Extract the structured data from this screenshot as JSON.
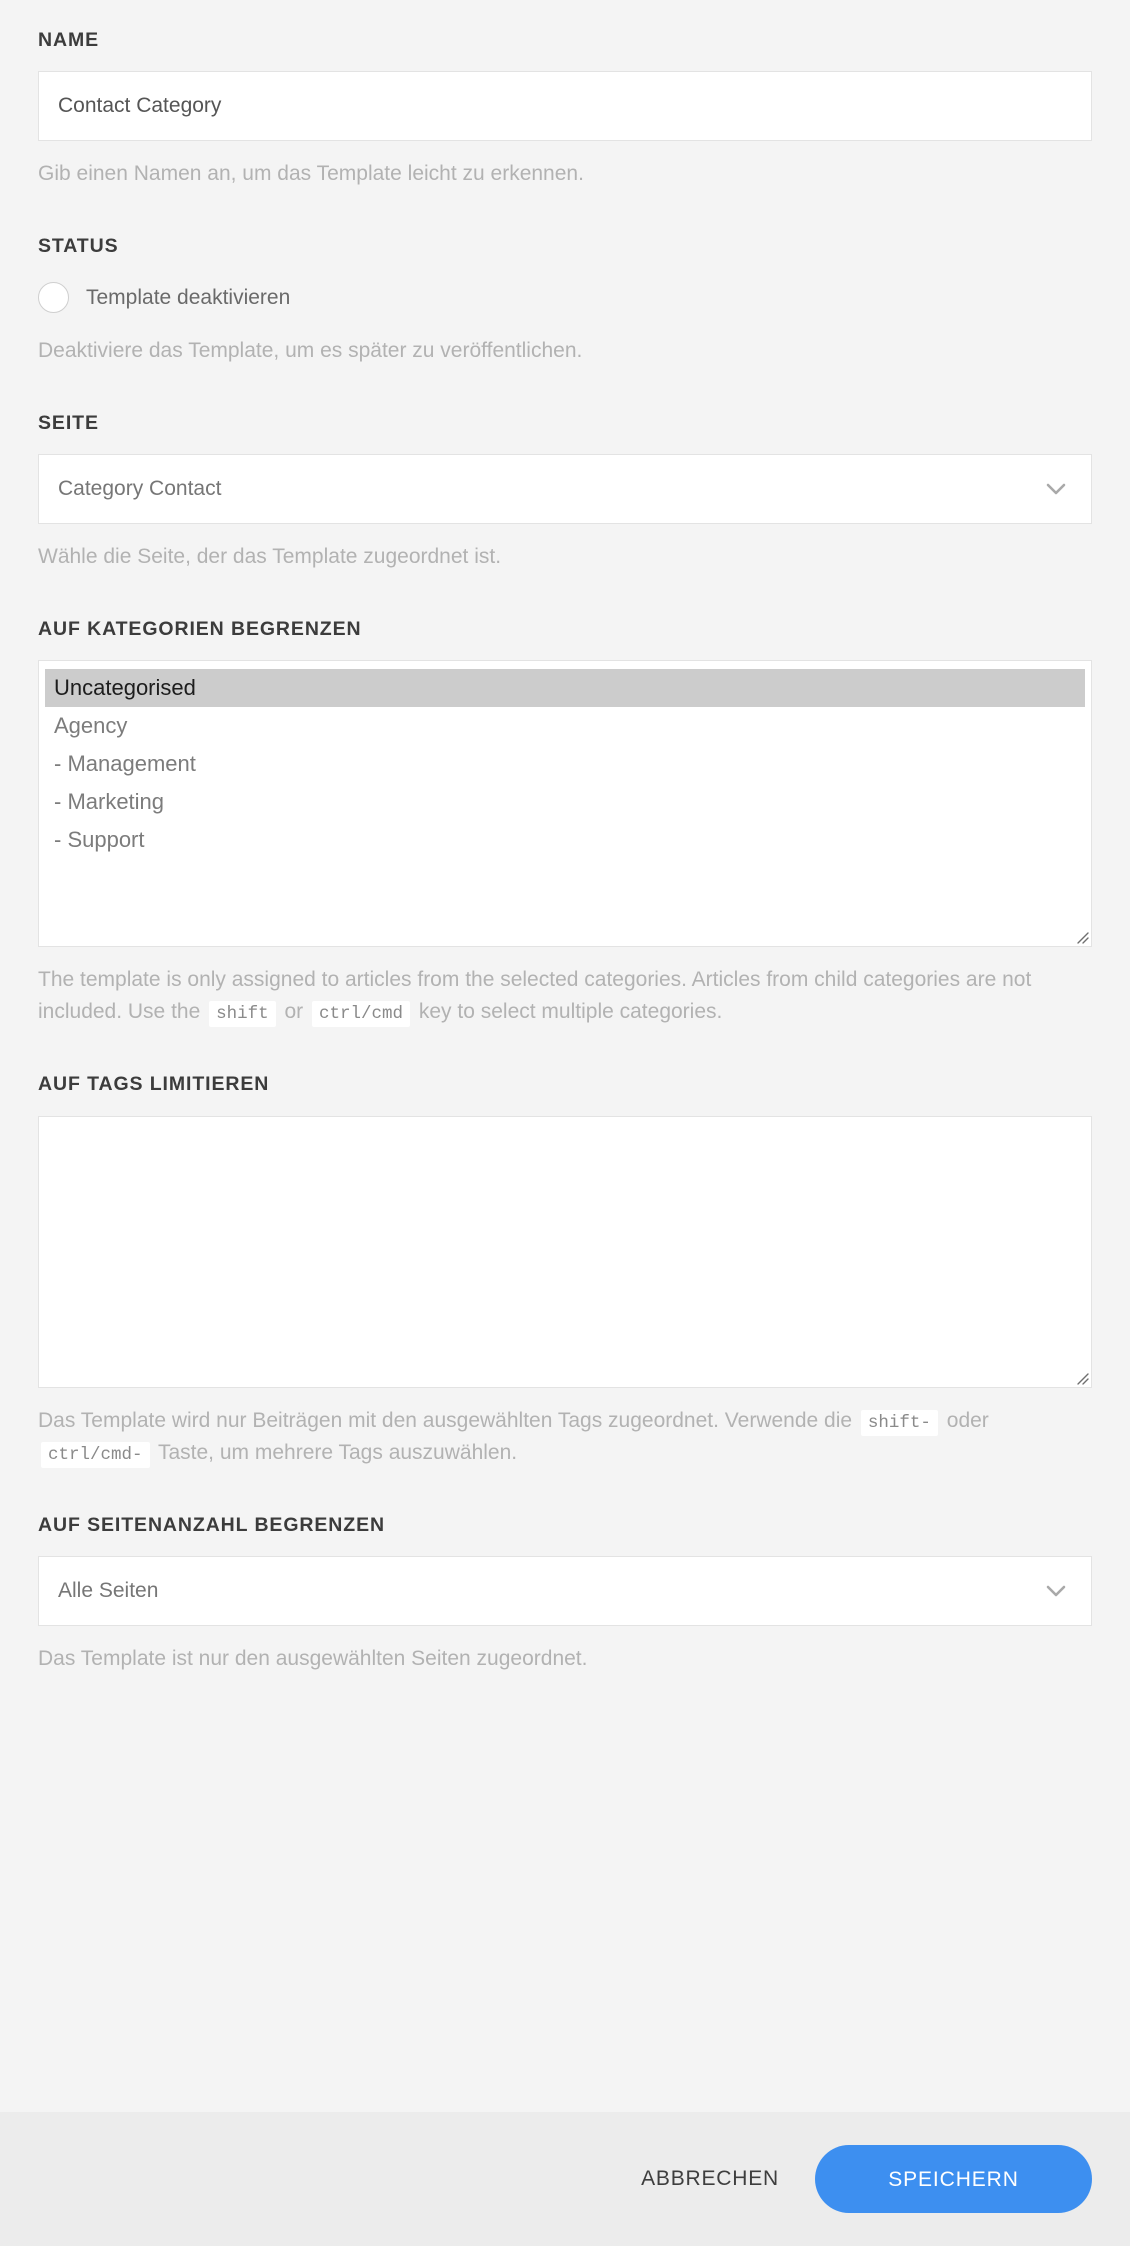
{
  "form": {
    "name_field": {
      "label": "NAME",
      "value": "Contact Category",
      "help": "Gib einen Namen an, um das Template leicht zu erkennen."
    },
    "status_field": {
      "label": "STATUS",
      "checkbox_label": "Template deaktivieren",
      "checked": false,
      "help": "Deaktiviere das Template, um es später zu veröffentlichen."
    },
    "page_field": {
      "label": "SEITE",
      "value": "Category Contact",
      "help": "Wähle die Seite, der das Template zugeordnet ist.",
      "chevron_icon": "chevron-down-icon"
    },
    "categories_field": {
      "label": "AUF KATEGORIEN BEGRENZEN",
      "options": [
        {
          "text": "Uncategorised",
          "selected": true
        },
        {
          "text": "Agency",
          "selected": false
        },
        {
          "text": "- Management",
          "selected": false
        },
        {
          "text": "- Marketing",
          "selected": false
        },
        {
          "text": "- Support",
          "selected": false
        }
      ],
      "help_part1": "The template is only assigned to articles from the selected categories. Articles from child categories are not included. Use the",
      "help_key1": "shift",
      "help_part2": "or",
      "help_key2": "ctrl/cmd",
      "help_part3": "key to select multiple categories."
    },
    "tags_field": {
      "label": "AUF TAGS LIMITIEREN",
      "value": "",
      "help_part1": "Das Template wird nur Beiträgen mit den ausgewählten Tags zugeordnet. Verwende die",
      "help_key1": "shift-",
      "help_part2": "oder",
      "help_key2": "ctrl/cmd-",
      "help_part3": "Taste, um mehrere Tags auszuwählen."
    },
    "pages_field": {
      "label": "AUF SEITENANZAHL BEGRENZEN",
      "value": "Alle Seiten",
      "help": "Das Template ist nur den ausgewählten Seiten zugeordnet.",
      "chevron_icon": "chevron-down-icon"
    }
  },
  "footer": {
    "cancel_label": "ABBRECHEN",
    "save_label": "SPEICHERN"
  },
  "colors": {
    "page_background": "#f4f4f4",
    "footer_background": "#ececec",
    "primary": "#3d8ff0",
    "label": "#3c3c3c",
    "help_text": "#b2b2b2",
    "input_border": "#e3e3e3",
    "selected_option": "#cccccc"
  }
}
